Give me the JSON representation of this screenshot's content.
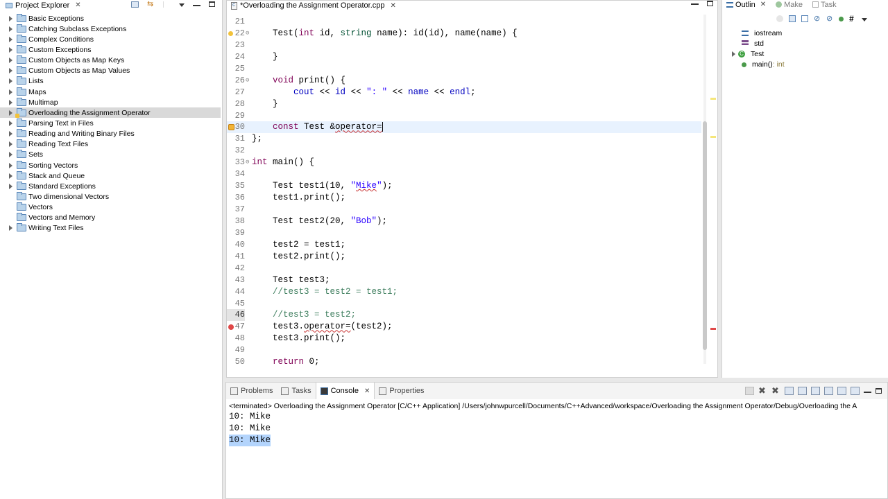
{
  "explorer": {
    "title": "Project Explorer",
    "projects": [
      {
        "name": "Basic Exceptions",
        "expandable": true
      },
      {
        "name": "Catching Subclass Exceptions",
        "expandable": true
      },
      {
        "name": "Complex Conditions",
        "expandable": true
      },
      {
        "name": "Custom Exceptions",
        "expandable": true
      },
      {
        "name": "Custom Objects as Map Keys",
        "expandable": true
      },
      {
        "name": "Custom Objects as Map Values",
        "expandable": true
      },
      {
        "name": "Lists",
        "expandable": true
      },
      {
        "name": "Maps",
        "expandable": true
      },
      {
        "name": "Multimap",
        "expandable": true
      },
      {
        "name": "Overloading the Assignment Operator",
        "expandable": true,
        "selected": true
      },
      {
        "name": "Parsing Text in Files",
        "expandable": true
      },
      {
        "name": "Reading and Writing Binary Files",
        "expandable": true
      },
      {
        "name": "Reading Text Files",
        "expandable": true
      },
      {
        "name": "Sets",
        "expandable": true
      },
      {
        "name": "Sorting Vectors",
        "expandable": true
      },
      {
        "name": "Stack and Queue",
        "expandable": true
      },
      {
        "name": "Standard Exceptions",
        "expandable": true
      },
      {
        "name": "Two dimensional Vectors",
        "expandable": false
      },
      {
        "name": "Vectors",
        "expandable": false
      },
      {
        "name": "Vectors and Memory",
        "expandable": false
      },
      {
        "name": "Writing Text Files",
        "expandable": true
      }
    ]
  },
  "editor": {
    "tab_title": "*Overloading the Assignment Operator.cpp",
    "line_numbers": [
      "21",
      "22",
      "23",
      "24",
      "25",
      "26",
      "27",
      "28",
      "29",
      "30",
      "31",
      "32",
      "33",
      "34",
      "35",
      "36",
      "37",
      "38",
      "39",
      "40",
      "41",
      "42",
      "43",
      "44",
      "45",
      "46",
      "47",
      "48",
      "49",
      "50"
    ]
  },
  "outline": {
    "tabs": [
      "Outlin",
      "Make",
      "Task"
    ],
    "items": [
      {
        "name": "iostream",
        "icon": "include-icon"
      },
      {
        "name": "std",
        "icon": "namespace-icon"
      },
      {
        "name": "Test",
        "icon": "class-icon"
      },
      {
        "name": "main()",
        "type": " : int",
        "icon": "function-icon"
      }
    ]
  },
  "console": {
    "tabs": [
      "Problems",
      "Tasks",
      "Console",
      "Properties"
    ],
    "terminated": "<terminated> Overloading the Assignment Operator [C/C++ Application] /Users/johnwpurcell/Documents/C++Advanced/workspace/Overloading the Assignment Operator/Debug/Overloading the A",
    "output": [
      "10: Mike",
      "10: Mike",
      "10: Mike"
    ]
  },
  "colors": {
    "keyword": "#7f0055",
    "string": "#2a00ff",
    "comment": "#3f7f5f",
    "selection": "#b3d4fc",
    "current_line": "#e8f2fe"
  }
}
